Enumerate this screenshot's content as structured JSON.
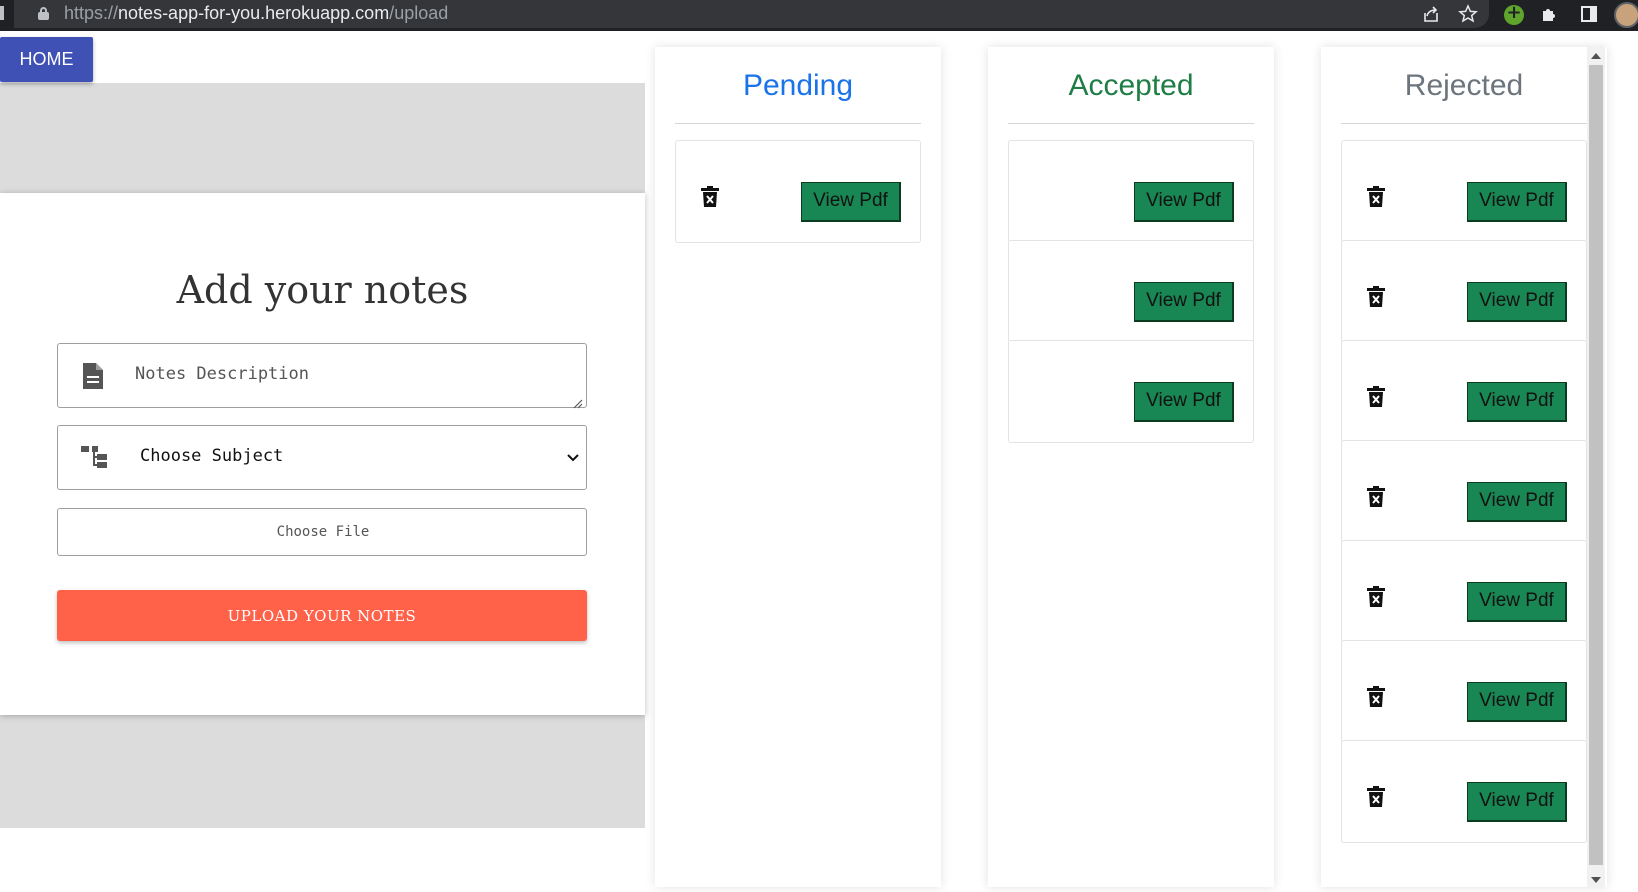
{
  "browser": {
    "url_scheme": "https://",
    "url_host": "notes-app-for-you.herokuapp.com",
    "url_path": "/upload"
  },
  "nav": {
    "home_label": "HOME"
  },
  "form": {
    "title": "Add your notes",
    "description_placeholder": "Notes Description",
    "subject_selected": "Choose Subject",
    "file_label": "Choose File",
    "submit_label": "UPLOAD YOUR NOTES"
  },
  "columns": {
    "pending": {
      "title": "Pending",
      "items": [
        {
          "view_label": "View Pdf",
          "has_delete": true
        }
      ]
    },
    "accepted": {
      "title": "Accepted",
      "items": [
        {
          "view_label": "View Pdf",
          "has_delete": false
        },
        {
          "view_label": "View Pdf",
          "has_delete": false
        },
        {
          "view_label": "View Pdf",
          "has_delete": false
        }
      ]
    },
    "rejected": {
      "title": "Rejected",
      "items": [
        {
          "view_label": "View Pdf",
          "has_delete": true
        },
        {
          "view_label": "View Pdf",
          "has_delete": true
        },
        {
          "view_label": "View Pdf",
          "has_delete": true
        },
        {
          "view_label": "View Pdf",
          "has_delete": true
        },
        {
          "view_label": "View Pdf",
          "has_delete": true
        },
        {
          "view_label": "View Pdf",
          "has_delete": true
        },
        {
          "view_label": "View Pdf",
          "has_delete": true
        }
      ]
    }
  },
  "colors": {
    "home_button": "#3f51b5",
    "upload_button": "#ff6149",
    "view_button": "#198754",
    "pending_title": "#1a73e8",
    "accepted_title": "#1e7e45",
    "rejected_title": "#6c757d"
  },
  "icons": {
    "lock": "lock-icon",
    "share": "share-icon",
    "bookmark": "star-icon",
    "extension": "puzzle-icon",
    "sidepanel": "side-panel-icon",
    "description": "document-icon",
    "subject": "sitemap-icon",
    "delete": "trash-x-icon"
  }
}
